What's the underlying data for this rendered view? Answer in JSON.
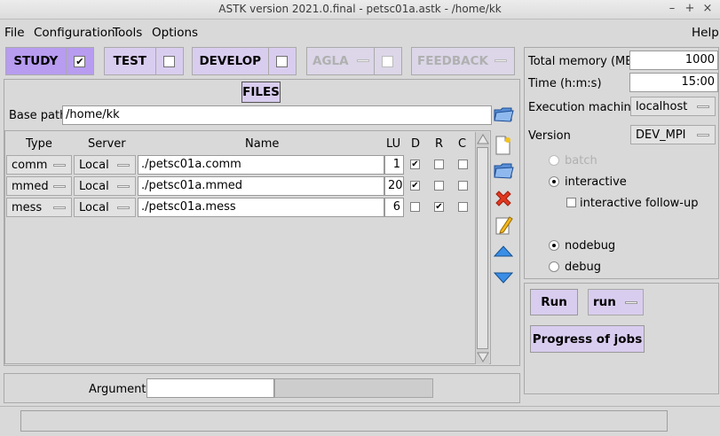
{
  "window": {
    "title": "ASTK version 2021.0.final - petsc01a.astk - /home/kk",
    "controls": [
      "–",
      "+",
      "×"
    ]
  },
  "menu": {
    "file": "File",
    "configuration": "Configuration",
    "tools": "Tools",
    "options": "Options",
    "help": "Help"
  },
  "modes": {
    "study": {
      "label": "STUDY",
      "checked": "✔"
    },
    "test": {
      "label": "TEST"
    },
    "develop": {
      "label": "DEVELOP"
    },
    "agla": {
      "label": "AGLA"
    },
    "feedback": {
      "label": "FEEDBACK"
    }
  },
  "files": {
    "title": "FILES",
    "base_path_label": "Base path",
    "base_path": "/home/kk",
    "headers": {
      "type": "Type",
      "server": "Server",
      "name": "Name",
      "lu": "LU",
      "d": "D",
      "r": "R",
      "c": "C"
    },
    "rows": [
      {
        "type": "comm",
        "server": "Local",
        "name": "./petsc01a.comm",
        "lu": "1",
        "d": "✔",
        "r": "",
        "c": ""
      },
      {
        "type": "mmed",
        "server": "Local",
        "name": "./petsc01a.mmed",
        "lu": "20",
        "d": "✔",
        "r": "",
        "c": ""
      },
      {
        "type": "mess",
        "server": "Local",
        "name": "./petsc01a.mess",
        "lu": "6",
        "d": "",
        "r": "✔",
        "c": ""
      }
    ],
    "arguments_label": "Arguments",
    "arguments_value": ""
  },
  "settings": {
    "memory_label": "Total memory (MB)",
    "memory_value": "1000",
    "time_label": "Time (h:m:s)",
    "time_value": "15:00",
    "machine_label": "Execution machine",
    "machine_value": "localhost",
    "version_label": "Version",
    "version_value": "DEV_MPI",
    "batch": "batch",
    "interactive": "interactive",
    "follow_up": "interactive follow-up",
    "nodebug": "nodebug",
    "debug": "debug"
  },
  "actions": {
    "run": "Run",
    "run_mode": "run",
    "progress": "Progress of jobs"
  },
  "status": ""
}
